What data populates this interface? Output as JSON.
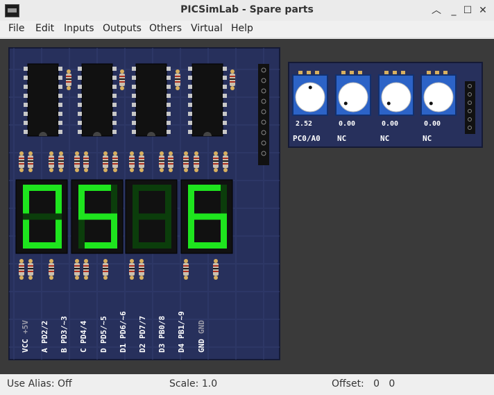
{
  "window": {
    "title": "PICSimLab - Spare parts"
  },
  "menu": [
    "File",
    "Edit",
    "Inputs",
    "Outputs",
    "Others",
    "Virtual",
    "Help"
  ],
  "board": {
    "digits": [
      "0",
      "5",
      "8",
      "6"
    ],
    "digit_lit": [
      true,
      true,
      false,
      true
    ],
    "pins": [
      {
        "name": "VCC",
        "signal": "+5V"
      },
      {
        "name": "A",
        "signal": "PD2/2"
      },
      {
        "name": "B",
        "signal": "PD3/~3"
      },
      {
        "name": "C",
        "signal": "PD4/4"
      },
      {
        "name": "D",
        "signal": "PD5/~5"
      },
      {
        "name": "D1",
        "signal": "PD6/~6"
      },
      {
        "name": "D2",
        "signal": "PD7/7"
      },
      {
        "name": "D3",
        "signal": "PB0/8"
      },
      {
        "name": "D4",
        "signal": "PB1/~9"
      },
      {
        "name": "GND",
        "signal": "GND"
      }
    ]
  },
  "pots": [
    {
      "value": "2.52",
      "label": "PC0/A0"
    },
    {
      "value": "0.00",
      "label": "NC"
    },
    {
      "value": "0.00",
      "label": "NC"
    },
    {
      "value": "0.00",
      "label": "NC"
    }
  ],
  "status": {
    "alias": "Use Alias: Off",
    "scale": "Scale: 1.0",
    "offset": "Offset:   0   0"
  },
  "colors": {
    "pcb": "#27305c",
    "segment_on": "#1ee51e",
    "segment_off": "#0b3d0b",
    "canvas": "#3a3a3a",
    "pot_body": "#2c63c7"
  },
  "icons": {
    "close": "close-icon",
    "minimize": "minimize-icon",
    "maximize": "maximize-icon",
    "restore": "chevron-up-icon"
  }
}
